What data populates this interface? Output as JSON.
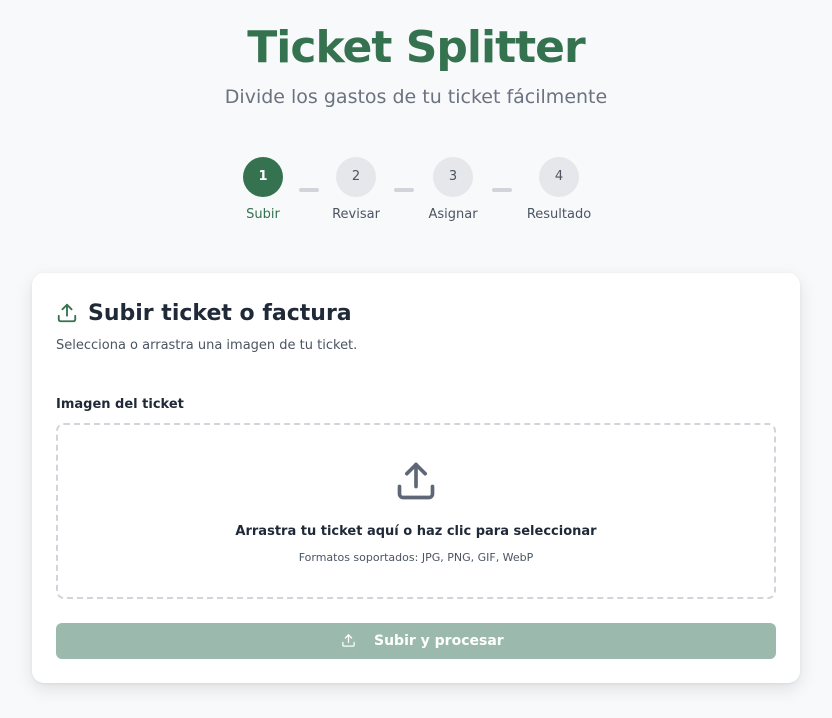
{
  "header": {
    "title": "Ticket Splitter",
    "subtitle": "Divide los gastos de tu ticket fácilmente"
  },
  "stepper": {
    "current_step": 1,
    "steps": [
      {
        "number": "1",
        "label": "Subir"
      },
      {
        "number": "2",
        "label": "Revisar"
      },
      {
        "number": "3",
        "label": "Asignar"
      },
      {
        "number": "4",
        "label": "Resultado"
      }
    ]
  },
  "upload_card": {
    "icon": "upload-icon",
    "title": "Subir ticket o factura",
    "description": "Selecciona o arrastra una imagen de tu ticket.",
    "field_label": "Imagen del ticket",
    "dropzone": {
      "icon": "upload-icon",
      "text": "Arrastra tu ticket aquí o haz clic para seleccionar",
      "hint": "Formatos soportados: JPG, PNG, GIF, WebP"
    },
    "submit_button": {
      "icon": "upload-icon",
      "label": "Subir y procesar",
      "disabled": true
    }
  },
  "colors": {
    "brand": "#35724f",
    "button_disabled": "#9bbaad",
    "step_inactive": "#e5e7eb",
    "background": "#f8f9fb"
  }
}
